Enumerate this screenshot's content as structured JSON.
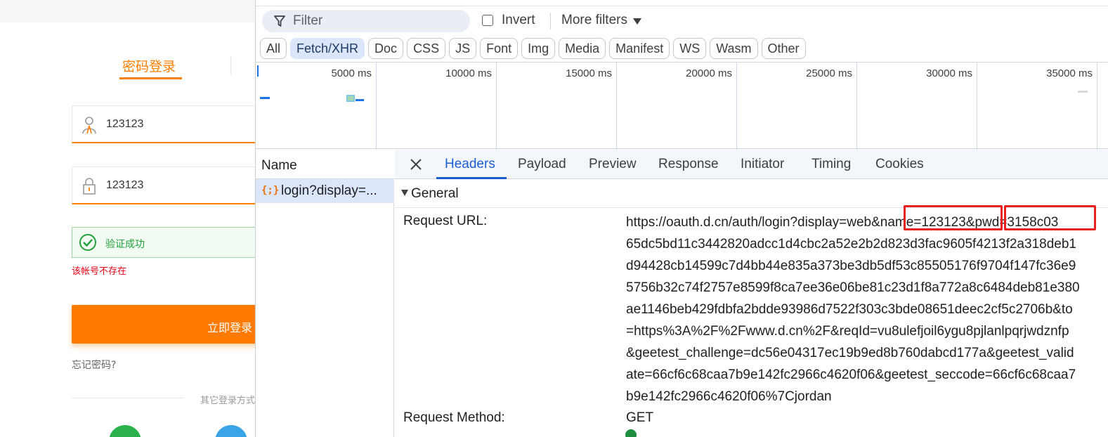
{
  "login": {
    "tab_label": "密码登录",
    "username_value": "123123",
    "password_value": "123123",
    "verify_text": "验证成功",
    "error_text": "该帐号不存在",
    "login_button": "立即登录",
    "forgot_link": "忘记密码?",
    "other_login_text": "其它登录方式",
    "colors": {
      "accent": "#ff7f00",
      "success": "#22a03c",
      "error": "#e60012"
    }
  },
  "devtools": {
    "filter": {
      "placeholder": "Filter",
      "invert_label": "Invert",
      "more_filters_label": "More filters"
    },
    "type_filters": [
      {
        "label": "All",
        "active": false
      },
      {
        "label": "Fetch/XHR",
        "active": true
      },
      {
        "label": "Doc",
        "active": false
      },
      {
        "label": "CSS",
        "active": false
      },
      {
        "label": "JS",
        "active": false
      },
      {
        "label": "Font",
        "active": false
      },
      {
        "label": "Img",
        "active": false
      },
      {
        "label": "Media",
        "active": false
      },
      {
        "label": "Manifest",
        "active": false
      },
      {
        "label": "WS",
        "active": false
      },
      {
        "label": "Wasm",
        "active": false
      },
      {
        "label": "Other",
        "active": false
      }
    ],
    "timeline_ticks": [
      "5000 ms",
      "10000 ms",
      "15000 ms",
      "20000 ms",
      "25000 ms",
      "30000 ms",
      "35000 ms"
    ],
    "name_column": {
      "header": "Name",
      "rows": [
        "login?display=..."
      ]
    },
    "xhr_icon_glyph": "{;}",
    "detail_tabs": [
      "Headers",
      "Payload",
      "Preview",
      "Response",
      "Initiator",
      "Timing",
      "Cookies"
    ],
    "active_detail_tab": "Headers",
    "general_section": {
      "title": "General",
      "request_url_label": "Request URL:",
      "request_url_lines": [
        "https://oauth.d.cn/auth/login?display=web&name=123123&pwd=3158c03",
        "65dc5bd11c3442820adcc1d4cbc2a52e2b2d823d3fac9605f4213f2a318deb1",
        "d94428cb14599c7d4bb44e835a373be3db5df53c85505176f9704f147fc36e9",
        "5756b32c74f2757e8599f8ca7ee36e06be81c23d1f8a772a8c6484deb81e380",
        "ae1146beb429fdbfa2bdde93986d7522f303c3bde08651deec2cf5c2706b&to",
        "=https%3A%2F%2Fwww.d.cn%2F&reqId=vu8ulefjoil6ygu8pjlanlpqrjwdznfp",
        "&geetest_challenge=dc56e04317ec19b9ed8b760dabcd177a&geetest_valid",
        "ate=66cf6c68caa7b9e142fc2966c4620f06&geetest_seccode=66cf6c68caa7",
        "b9e142fc2966c4620f06%7Cjordan"
      ],
      "request_method_label": "Request Method:",
      "request_method_value": "GET"
    },
    "colors": {
      "active_tab": "#1a5fd1",
      "highlight_box": "#e6201e",
      "xhr_icon": "#e8710a"
    }
  }
}
